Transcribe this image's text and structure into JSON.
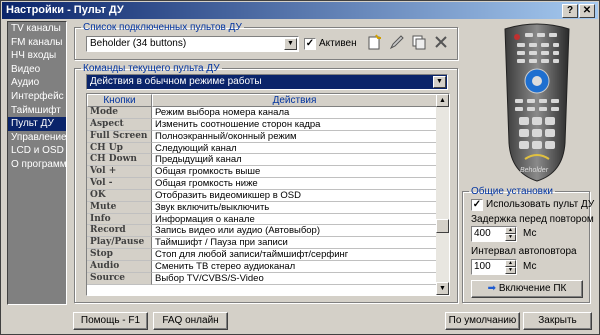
{
  "window": {
    "title": "Настройки - Пульт ДУ"
  },
  "nav": {
    "items": [
      {
        "label": "TV каналы",
        "active": false
      },
      {
        "label": "FM каналы",
        "active": false
      },
      {
        "label": "НЧ входы",
        "active": false
      },
      {
        "label": "Видео",
        "active": false
      },
      {
        "label": "Аудио",
        "active": false
      },
      {
        "label": "Интерфейс",
        "active": false
      },
      {
        "label": "Таймшифт",
        "active": false
      },
      {
        "label": "Пульт ДУ",
        "active": true
      },
      {
        "label": "Управление",
        "active": false
      },
      {
        "label": "LCD и OSD",
        "active": false
      },
      {
        "label": "О программе",
        "active": false
      }
    ]
  },
  "remotes_group": {
    "legend": "Список подключенных пультов ДУ",
    "selected": "Beholder (34 buttons)",
    "active_label": "Активен",
    "active_checked": true
  },
  "commands_group": {
    "legend": "Команды текущего пульта ДУ",
    "mode": "Действия в обычном режиме работы",
    "col_buttons": "Кнопки",
    "col_actions": "Действия",
    "rows": [
      {
        "key": "Mode",
        "action": "Режим выбора номера канала"
      },
      {
        "key": "Aspect",
        "action": "Изменить соотношение сторон кадра"
      },
      {
        "key": "Full Screen",
        "action": "Полноэкранный/оконный режим"
      },
      {
        "key": "CH Up",
        "action": "Следующий канал"
      },
      {
        "key": "CH Down",
        "action": "Предыдущий канал"
      },
      {
        "key": "Vol +",
        "action": "Общая громкость выше"
      },
      {
        "key": "Vol -",
        "action": "Общая громкость ниже"
      },
      {
        "key": "OK",
        "action": "Отобразить видеомикшер в OSD"
      },
      {
        "key": "Mute",
        "action": "Звук включить/выключить"
      },
      {
        "key": "Info",
        "action": "Информация о канале"
      },
      {
        "key": "Record",
        "action": "Запись видео или аудио (Автовыбор)"
      },
      {
        "key": "Play/Pause",
        "action": "Таймшифт / Пауза при записи"
      },
      {
        "key": "Stop",
        "action": "Стоп для любой записи/таймшифт/серфинг"
      },
      {
        "key": "Audio",
        "action": "Сменить ТВ стерео аудиоканал"
      },
      {
        "key": "Source",
        "action": "Выбор TV/CVBS/S-Video"
      }
    ]
  },
  "general_group": {
    "legend": "Общие установки",
    "use_remote_label": "Использовать пульт ДУ",
    "use_remote_checked": true,
    "repeat_delay_label": "Задержка перед повтором",
    "repeat_delay_value": "400",
    "repeat_delay_unit": "Мс",
    "autorepeat_label": "Интервал автоповтора",
    "autorepeat_value": "100",
    "autorepeat_unit": "Мс",
    "pc_power_button": "Включение ПК"
  },
  "footer": {
    "help_button": "Помощь - F1",
    "faq_button": "FAQ онлайн",
    "defaults_button": "По умолчанию",
    "close_button": "Закрыть"
  },
  "remote_image": {
    "brand": "Beholder"
  },
  "icons": [
    "help-icon",
    "close-icon",
    "new-remote-icon",
    "edit-remote-icon",
    "copy-remote-icon",
    "delete-remote-icon",
    "power-icon"
  ]
}
